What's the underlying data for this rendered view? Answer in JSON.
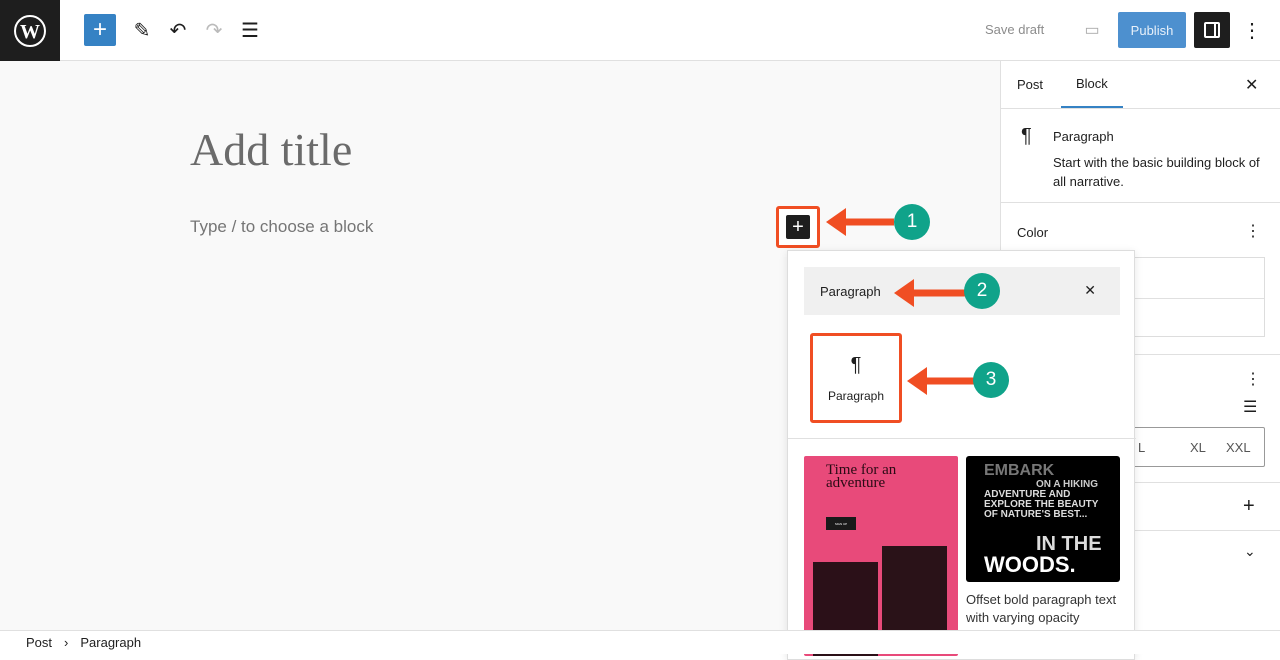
{
  "topbar": {
    "save_draft": "Save draft",
    "publish": "Publish"
  },
  "editor": {
    "title_placeholder": "Add title",
    "block_placeholder": "Type / to choose a block"
  },
  "annotations": {
    "steps": [
      "1",
      "2",
      "3"
    ],
    "arrow_color": "#f04e23",
    "badge_color": "#10a38a"
  },
  "sidebar": {
    "tabs": [
      "Post",
      "Block"
    ],
    "active_tab": "Block",
    "block_name": "Paragraph",
    "block_desc": "Start with the basic building block of all narrative.",
    "color_label": "Color",
    "sizes": [
      "L",
      "XL",
      "XXL"
    ]
  },
  "popover": {
    "search_value": "Paragraph",
    "result_label": "Paragraph",
    "pattern1": {
      "heading": "Time for an adventure",
      "button": "SIGN UP"
    },
    "pattern2": {
      "line1": "EMBARK",
      "line2": "ON A HIKING",
      "line3": "ADVENTURE AND EXPLORE THE BEAUTY OF NATURE'S BEST...",
      "line4": "IN THE",
      "line5": "WOODS.",
      "caption": "Offset bold paragraph text with varying opacity"
    }
  },
  "footer": {
    "breadcrumb": [
      "Post",
      "Paragraph"
    ]
  }
}
